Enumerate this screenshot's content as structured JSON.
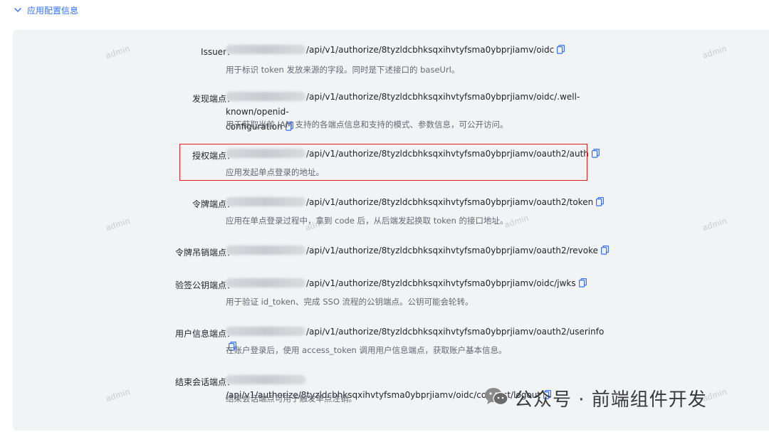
{
  "section": {
    "title": "应用配置信息"
  },
  "endpoints": [
    {
      "label": "Issuer：",
      "path": "/api/v1/authorize/8tyzldcbhksqxihvtyfsma0ybprjiamv/oidc",
      "path_cont": "",
      "desc": "用于标识 token 发放来源的字段。同时是下述接口的 baseUrl。"
    },
    {
      "label": "发现端点：",
      "path": "/api/v1/authorize/8tyzldcbhksqxihvtyfsma0ybprjiamv/oidc/.well-known/openid-",
      "path_cont": "configuration",
      "desc": "用于获取当前 IAM 支持的各端点信息和支持的模式、参数信息，可公开访问。"
    },
    {
      "label": "授权端点：",
      "path": "/api/v1/authorize/8tyzldcbhksqxihvtyfsma0ybprjiamv/oauth2/auth",
      "path_cont": "",
      "desc": "应用发起单点登录的地址。"
    },
    {
      "label": "令牌端点：",
      "path": "/api/v1/authorize/8tyzldcbhksqxihvtyfsma0ybprjiamv/oauth2/token",
      "path_cont": "",
      "desc": "应用在单点登录过程中，拿到 code 后，从后端发起换取 token 的接口地址。"
    },
    {
      "label": "令牌吊销端点：",
      "path": "/api/v1/authorize/8tyzldcbhksqxihvtyfsma0ybprjiamv/oauth2/revoke",
      "path_cont": "",
      "desc": ""
    },
    {
      "label": "验签公钥端点：",
      "path": "/api/v1/authorize/8tyzldcbhksqxihvtyfsma0ybprjiamv/oidc/jwks",
      "path_cont": "",
      "desc": "用于验证 id_token、完成 SSO 流程的公钥端点。公钥可能会轮转。"
    },
    {
      "label": "用户信息端点：",
      "path": "/api/v1/authorize/8tyzldcbhksqxihvtyfsma0ybprjiamv/oauth2/userinfo",
      "path_cont": "",
      "desc": "在账户登录后，使用 access_token 调用用户信息端点，获取账户基本信息。"
    },
    {
      "label": "结束会话端点：",
      "path": "/api/v1/authorize/8tyzldcbhksqxihvtyfsma0ybprjiamv/oidc/connect/logout",
      "path_cont": "",
      "desc": "结束会话端点可用于触发单点注销。"
    }
  ],
  "watermark": "admin",
  "brand": {
    "text": "公众号 · 前端组件开发"
  },
  "colors": {
    "accent": "#3370ff",
    "highlight": "#e02020",
    "panel": "#f2f3f5"
  }
}
